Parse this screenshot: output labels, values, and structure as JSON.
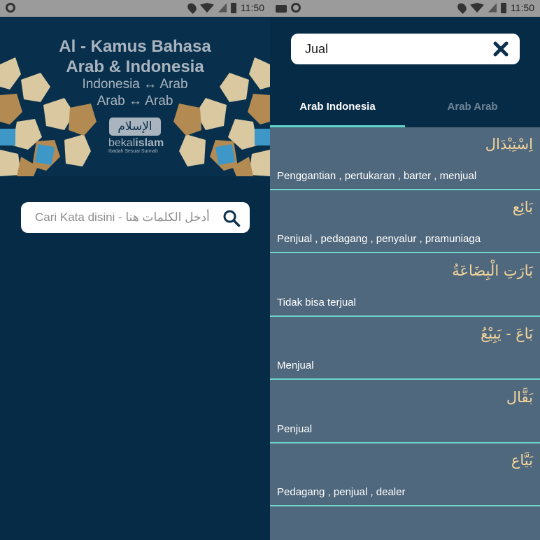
{
  "status_bar": {
    "time": "11:50"
  },
  "home": {
    "title_line1": "Al - Kamus Bahasa",
    "title_line2": "Arab & Indonesia",
    "subtitle_line1": "Indonesia ↔ Arab",
    "subtitle_line2": "Arab ↔ Arab",
    "logo_arabic": "الإسلام",
    "logo_word_prefix": "bekal",
    "logo_word_bold": "islam",
    "logo_tagline": "Ibadah Sesuai Sunnah",
    "search_placeholder": "Cari Kata disini - أدخل الكلمات هنا",
    "colors": {
      "background": "#062b47",
      "text": "#a9b4bf"
    }
  },
  "results": {
    "search_value": "Jual",
    "tabs": [
      {
        "label": "Arab  Indonesia",
        "active": true
      },
      {
        "label": "Arab  Arab",
        "active": false
      }
    ],
    "items": [
      {
        "arabic": "اِسْتِبْدَال",
        "meaning": "Penggantian , pertukaran , barter , menjual"
      },
      {
        "arabic": "بَائِع",
        "meaning": "Penjual , pedagang , penyalur , pramuniaga"
      },
      {
        "arabic": "بَارَتِ الْبِضَاعَةُ",
        "meaning": "Tidak bisa terjual"
      },
      {
        "arabic": "بَاعَ - يَبِيْعُ",
        "meaning": "Menjual"
      },
      {
        "arabic": "بَقَّال",
        "meaning": "Penjual"
      },
      {
        "arabic": "بَيَّاع",
        "meaning": "Pedagang , penjual , dealer"
      }
    ],
    "colors": {
      "list_bg": "#50687d",
      "divider": "#6fd4cc",
      "arabic_text": "#f3d59a",
      "tab_indicator": "#5fd2c9"
    }
  }
}
